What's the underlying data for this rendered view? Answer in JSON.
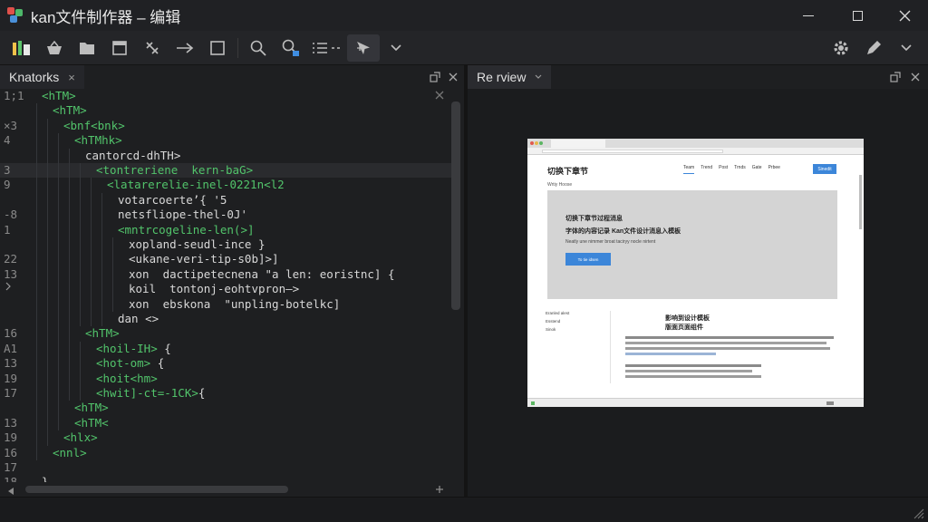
{
  "window": {
    "title": "kan文件制作器 – 编辑",
    "controls": [
      "minimize",
      "maximize",
      "close"
    ]
  },
  "toolbar": {
    "left": [
      "new-file-icon",
      "basket-icon",
      "folder-icon",
      "archive-icon",
      "wand-icon",
      "arrow-right-icon",
      "square-icon",
      "search-icon",
      "zoom-in-icon",
      "list-icon",
      "cursor-icon",
      "chevron-down-icon"
    ],
    "right": [
      "gear-icon",
      "pen-icon",
      "chevron-icon"
    ]
  },
  "editor_panel": {
    "tab_label": "Knatorks",
    "tab_close": "×",
    "lines": [
      {
        "ln": "1;1",
        "indent": 0,
        "tag": "<hTM>",
        "rest": ""
      },
      {
        "ln": "",
        "indent": 1,
        "tag": "<hTM>",
        "rest": ""
      },
      {
        "ln": "×3",
        "indent": 2,
        "tag": "<bnf<bnk>",
        "rest": ""
      },
      {
        "ln": "4",
        "indent": 3,
        "tag": "<hTMhk>",
        "rest": ""
      },
      {
        "ln": "",
        "indent": 4,
        "tag": "",
        "rest": "cantorcd-dhTH>"
      },
      {
        "ln": "3",
        "indent": 5,
        "tag": "<tontreriene  kern-baG>",
        "rest": ""
      },
      {
        "ln": "9",
        "indent": 6,
        "tag": "<latarerelie-inel-0221n<l2",
        "rest": ""
      },
      {
        "ln": "",
        "indent": 7,
        "tag": "",
        "rest": "votarcoerte’{ '5"
      },
      {
        "ln": "-8",
        "indent": 7,
        "tag": "",
        "rest": "netsfliope-thel-0J'"
      },
      {
        "ln": "1",
        "indent": 7,
        "tag": "<mntrcogeline-len(>]",
        "rest": ""
      },
      {
        "ln": "",
        "indent": 8,
        "tag": "",
        "rest": "xopland-seudl-ince }"
      },
      {
        "ln": "22",
        "indent": 8,
        "tag": "",
        "rest": "<ukane-veri-tip-s0b]>]"
      },
      {
        "ln": "13",
        "indent": 8,
        "tag": "",
        "rest": "xon  dactipetecnena \"a len: eoristnc] {"
      },
      {
        "ln": "",
        "indent": 8,
        "tag": "",
        "rest": "koil  tontonj-eohtvpron—>"
      },
      {
        "ln": "",
        "indent": 8,
        "tag": "",
        "rest": "xon  ebskona  \"unpling-botelkc]"
      },
      {
        "ln": "",
        "indent": 7,
        "tag": "",
        "rest": "dan <>"
      },
      {
        "ln": "16",
        "indent": 4,
        "tag": "<hTM>",
        "rest": ""
      },
      {
        "ln": "A1",
        "indent": 5,
        "tag": "<hoil-IH>",
        "rest": " {"
      },
      {
        "ln": "13",
        "indent": 5,
        "tag": "<hot-om>",
        "rest": " {"
      },
      {
        "ln": "19",
        "indent": 5,
        "tag": "<hoit<hm>",
        "rest": ""
      },
      {
        "ln": "17",
        "indent": 5,
        "tag": "<hwit]-ct=-1CK>",
        "rest": "{"
      },
      {
        "ln": "",
        "indent": 3,
        "tag": "<hTM>",
        "rest": ""
      },
      {
        "ln": "13",
        "indent": 3,
        "tag": "<hTM<",
        "rest": ""
      },
      {
        "ln": "19",
        "indent": 2,
        "tag": "<hlx>",
        "rest": ""
      },
      {
        "ln": "16",
        "indent": 1,
        "tag": "<nnl>",
        "rest": ""
      },
      {
        "ln": "17",
        "indent": 0,
        "tag": "",
        "rest": ""
      },
      {
        "ln": "18",
        "indent": 0,
        "tag": "",
        "rest": "}"
      }
    ]
  },
  "preview_panel": {
    "tab_label": "Re rview",
    "screenshot": {
      "site_logo": "切换下章节",
      "nav": [
        "Team",
        "Trend",
        "Post",
        "Trnds",
        "Gate",
        "Prbee"
      ],
      "nav_button": "Sinedit",
      "breadcrumb": "Wrtiy   Hoose",
      "hero_title1": "切换下章节过程消息",
      "hero_title2": "字体的内容记录 Kan文件设计消息入模板",
      "hero_sub": "Neatly une nimmer broat taciryy nocle nirtent",
      "hero_button": "To tie idsen",
      "side_items": [
        "Eranled alest",
        "Esstend",
        "Sinok"
      ],
      "section_title1": "影响到设计模板",
      "section_title2": "版面页面组件"
    }
  }
}
